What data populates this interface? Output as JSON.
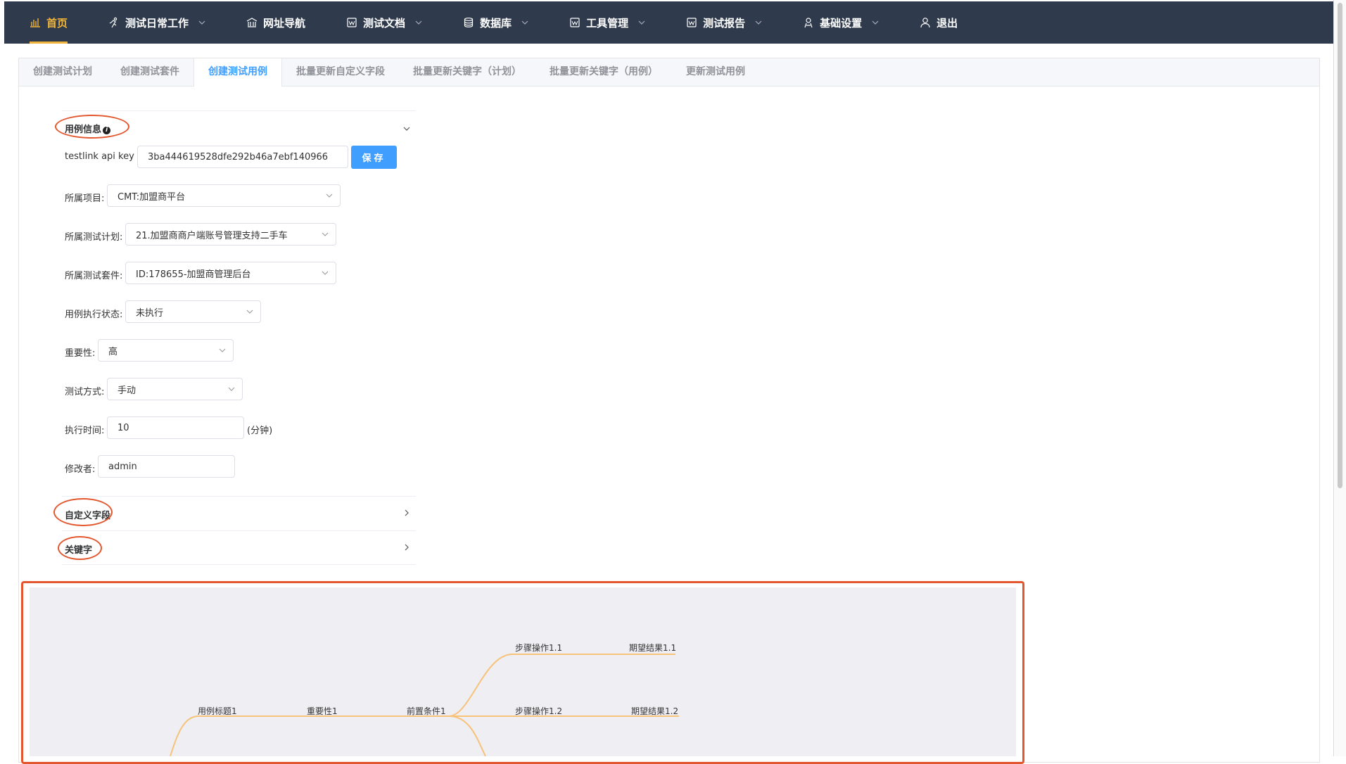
{
  "nav": {
    "items": [
      {
        "label": "首页",
        "icon": "bar-chart-icon",
        "active": true,
        "dropdown": false
      },
      {
        "label": "测试日常工作",
        "icon": "runner-icon",
        "active": false,
        "dropdown": true
      },
      {
        "label": "网址导航",
        "icon": "bank-icon",
        "active": false,
        "dropdown": false
      },
      {
        "label": "测试文档",
        "icon": "document-icon",
        "active": false,
        "dropdown": true
      },
      {
        "label": "数据库",
        "icon": "database-icon",
        "active": false,
        "dropdown": true
      },
      {
        "label": "工具管理",
        "icon": "tool-doc-icon",
        "active": false,
        "dropdown": true
      },
      {
        "label": "测试报告",
        "icon": "report-icon",
        "active": false,
        "dropdown": true
      },
      {
        "label": "基础设置",
        "icon": "setting-person-icon",
        "active": false,
        "dropdown": true
      },
      {
        "label": "退出",
        "icon": "user-icon",
        "active": false,
        "dropdown": false
      }
    ],
    "active_color": "#f0b43a",
    "bg_color": "#2f3a4c"
  },
  "tabs": [
    {
      "label": "创建测试计划",
      "active": false
    },
    {
      "label": "创建测试套件",
      "active": false
    },
    {
      "label": "创建测试用例",
      "active": true
    },
    {
      "label": "批量更新自定义字段",
      "active": false
    },
    {
      "label": "批量更新关键字（计划）",
      "active": false
    },
    {
      "label": "批量更新关键字（用例）",
      "active": false
    },
    {
      "label": "更新测试用例",
      "active": false
    }
  ],
  "form": {
    "section_case_info": "用例信息",
    "info_icon": "i",
    "api_key_label": "testlink api key :",
    "api_key_value": "3ba444619528dfe292b46a7ebf140966",
    "save_label": "保存",
    "project_label": "所属项目:",
    "project_value": "CMT:加盟商平台",
    "plan_label": "所属测试计划:",
    "plan_value": "21.加盟商商户端账号管理支持二手车",
    "suite_label": "所属测试套件:",
    "suite_value": "ID:178655-加盟商管理后台",
    "status_label": "用例执行状态:",
    "status_value": "未执行",
    "importance_label": "重要性:",
    "importance_value": "高",
    "method_label": "测试方式:",
    "method_value": "手动",
    "time_label": "执行时间:",
    "time_value": "10",
    "time_unit": "(分钟)",
    "modifier_label": "修改者:",
    "modifier_value": "admin",
    "section_custom": "自定义字段",
    "section_keywords": "关键字"
  },
  "mindmap": {
    "nodes": {
      "title": "用例标题1",
      "importance": "重要性1",
      "precondition": "前置条件1",
      "step_1_1": "步骤操作1.1",
      "expect_1_1": "期望结果1.1",
      "step_1_2": "步骤操作1.2",
      "expect_1_2": "期望结果1.2"
    },
    "line_color": "#f7c27a",
    "highlight_color": "#e4572e"
  }
}
